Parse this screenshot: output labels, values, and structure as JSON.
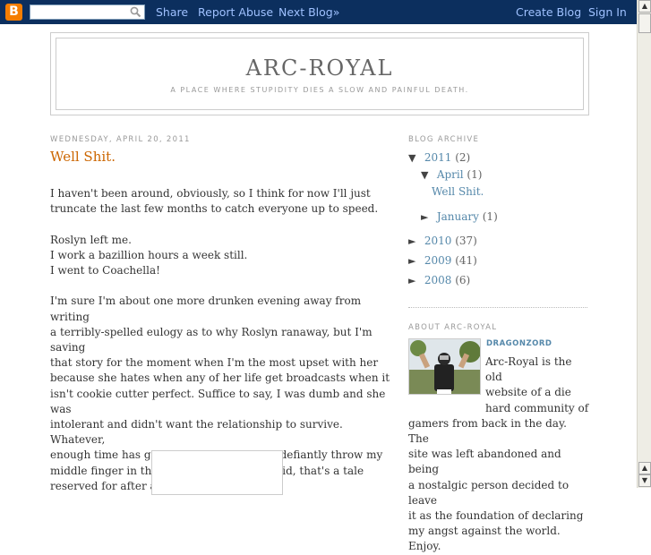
{
  "navbar": {
    "logo_letter": "B",
    "search": {
      "value": "",
      "placeholder": ""
    },
    "links": [
      "Share",
      "Report Abuse",
      "Next Blog»"
    ],
    "right_links": [
      "Create Blog",
      "Sign In"
    ]
  },
  "scrollbar": {
    "up": "▲",
    "down": "▼"
  },
  "header": {
    "title": "ARC-ROYAL",
    "description": "A place where stupidity dies a slow and painful death."
  },
  "post": {
    "date": "WEDNESDAY, APRIL 20, 2011",
    "title": "Well Shit.",
    "paragraphs": [
      [
        "I haven't been around, obviously, so I think for now I'll just",
        "truncate the last few months to catch everyone up to speed."
      ],
      [
        "Roslyn left me.",
        "I work a bazillion hours a week still.",
        "I went to Coachella!"
      ],
      [
        "I'm sure I'm about one more drunken evening away from writing",
        "a terribly-spelled eulogy as to why Roslyn ranaway, but I'm saving",
        "that story for the moment when I'm the most upset with her",
        "because she hates when any of her life get broadcasts when it",
        "isn't cookie cutter perfect. Suffice to say, I was dumb and she was",
        "intolerant and didn't want the relationship to survive. Whatever,",
        "enough time has gone by where I want to defiantly throw my",
        "middle finger in the air at her, but like I said, that's a tale",
        "reserved for after a fifth of jack daniels."
      ]
    ]
  },
  "sidebar": {
    "archive_heading": "BLOG ARCHIVE",
    "archive": {
      "y2011": {
        "toggle": "▼",
        "label": "2011",
        "count": "(2)"
      },
      "april": {
        "toggle": "▼",
        "label": "April",
        "count": "(1)"
      },
      "april_post": "Well Shit.",
      "january": {
        "toggle": "►",
        "label": "January",
        "count": "(1)"
      },
      "y2010": {
        "toggle": "►",
        "label": "2010",
        "count": "(37)"
      },
      "y2009": {
        "toggle": "►",
        "label": "2009",
        "count": "(41)"
      },
      "y2008": {
        "toggle": "►",
        "label": "2008",
        "count": "(6)"
      }
    },
    "about_heading": "ABOUT ARC-ROYAL",
    "profile_name": "DRAGONZORD",
    "about_lines_indented": [
      "Arc-Royal is the old",
      "website of a die",
      "hard community of"
    ],
    "about_lines": [
      "gamers from back in the day. The",
      "site was left abandoned and being",
      "a nostalgic person decided to leave",
      "it as the foundation of declaring",
      "my angst against the world. Enjoy."
    ]
  }
}
